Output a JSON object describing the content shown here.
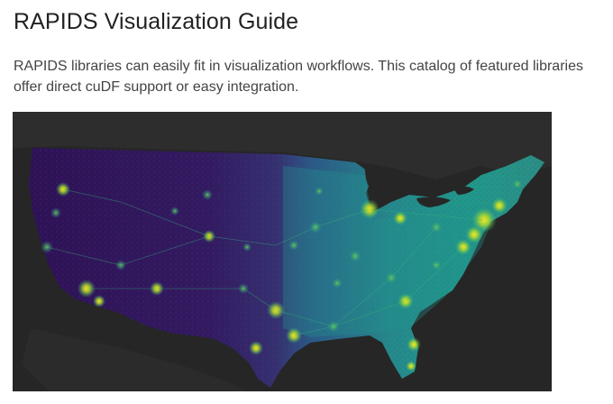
{
  "page": {
    "title": "RAPIDS Visualization Guide",
    "intro": "RAPIDS libraries can easily fit in visualization workflows. This catalog of featured libraries offer direct cuDF support or easy integration."
  },
  "map": {
    "colors": {
      "background": "#262626",
      "land_low": "#2b0f4a",
      "land_mid": "#3b2e7e",
      "land_high": "#21918c",
      "hotspot": "#c8e020",
      "peak": "#fde725"
    }
  }
}
